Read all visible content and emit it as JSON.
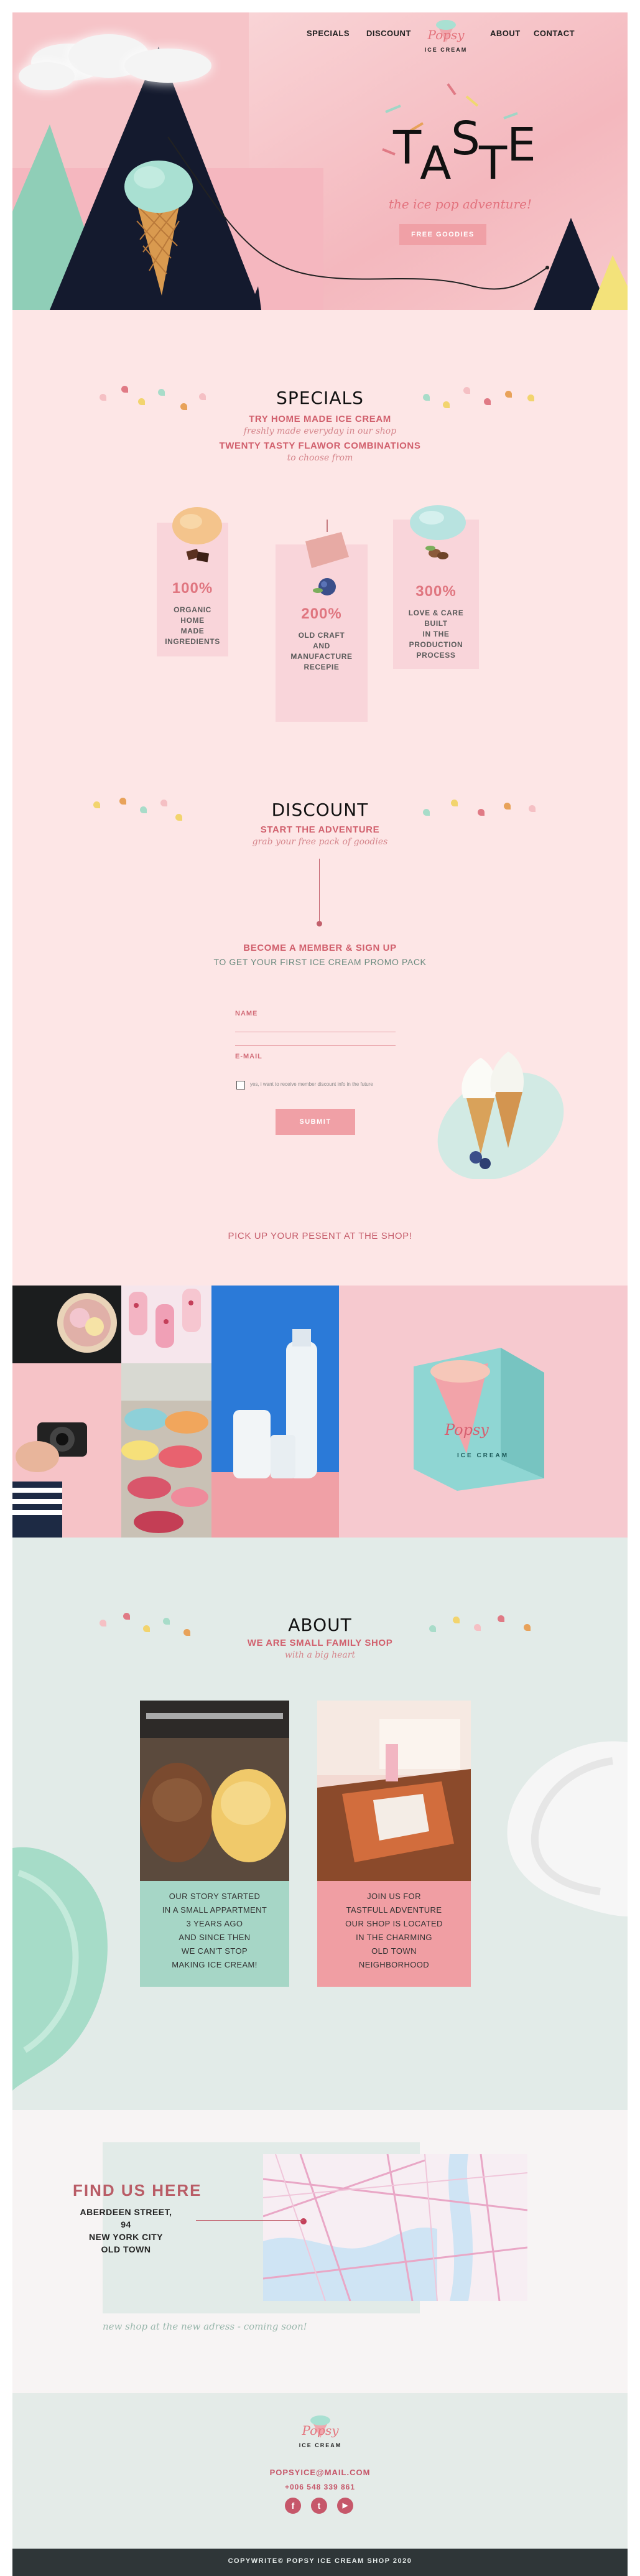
{
  "nav": {
    "specials": "SPECIALS",
    "discount": "DISCOUNT",
    "about": "ABOUT",
    "contact": "CONTACT"
  },
  "logo": {
    "word": "Popsy",
    "sub": "ICE CREAM"
  },
  "hero": {
    "taste_letters": [
      "T",
      "A",
      "S",
      "T",
      "E"
    ],
    "tagline": "the ice pop adventure!",
    "button": "FREE GOODIES"
  },
  "specials": {
    "title": "SPECIALS",
    "line1": "TRY HOME MADE ICE CREAM",
    "script1": "freshly made everyday in our shop",
    "line2": "TWENTY TASTY FLAWOR COMBINATIONS",
    "script2": "to choose from",
    "cards": [
      {
        "percent": "100%",
        "lines": [
          "ORGANIC",
          "HOME",
          "MADE",
          "INGREDIENTS"
        ]
      },
      {
        "percent": "200%",
        "lines": [
          "OLD CRAFT",
          "AND",
          "MANUFACTURE",
          "RECEPIE"
        ]
      },
      {
        "percent": "300%",
        "lines": [
          "LOVE & CARE",
          "BUILT",
          "IN THE",
          "PRODUCTION",
          "PROCESS"
        ]
      }
    ]
  },
  "discount": {
    "title": "DISCOUNT",
    "line1": "START THE ADVENTURE",
    "script1": "grab your free pack of goodies",
    "cta_title": "BECOME A MEMBER & SIGN UP",
    "cta_sub": "TO GET YOUR FIRST ICE CREAM PROMO PACK",
    "name_label": "NAME",
    "email_label": "E-MAIL",
    "checkbox_text": "yes, i want to receive member discount info in the future",
    "submit": "SUBMIT",
    "pickup": "PICK UP YOUR PESENT AT THE SHOP!"
  },
  "gallery": {
    "box_logo": "Popsy",
    "box_sub": "ICE CREAM"
  },
  "about": {
    "title": "ABOUT",
    "line1": "WE ARE SMALL FAMILY SHOP",
    "script1": "with a big heart",
    "left_text": [
      "OUR STORY STARTED",
      "IN A SMALL APPARTMENT",
      "3 YEARS AGO",
      "AND SINCE THEN",
      "WE CAN'T STOP",
      "MAKING ICE CREAM!"
    ],
    "right_text": [
      "JOIN US FOR",
      "TASTFULL ADVENTURE",
      "OUR SHOP IS LOCATED",
      "IN THE CHARMING",
      "OLD TOWN",
      "NEIGHBORHOOD"
    ]
  },
  "find": {
    "title": "FIND US HERE",
    "address": [
      "ABERDEEN STREET, 94",
      "NEW YORK CITY",
      "OLD TOWN"
    ],
    "script": "new shop at the new adress - coming soon!"
  },
  "footer": {
    "email": "POPSYICE@MAIL.COM",
    "phone": "+006 548 339 861",
    "social": [
      "f",
      "t",
      "▶"
    ],
    "copyright": "COPYWRITE© POPSY ICE CREAM SHOP 2020"
  },
  "colors": {
    "pink_bg": "#fde6e6",
    "accent": "#e4747d",
    "mint": "#9fd5c3",
    "navy": "#141a2e",
    "about_bg": "#e2ebe8",
    "footer_bg": "#e4ebe8",
    "copyright_bg": "#2f3638"
  }
}
